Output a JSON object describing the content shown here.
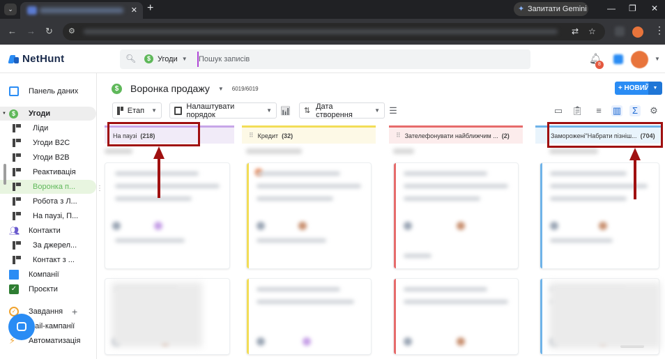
{
  "browser": {
    "gemini_label": "Запитати Gemini",
    "window_controls": [
      "—",
      "❐",
      "✕"
    ],
    "tab_close": "✕",
    "new_tab": "+"
  },
  "header": {
    "logo_text": "NetHunt",
    "search_scope": "Угоди",
    "search_placeholder": "Пошук записів",
    "notification_count": "8",
    "accent_color": "#2a8cf4"
  },
  "sidebar": {
    "items": [
      {
        "label": "Панель даних",
        "icon": "dashboard-icon"
      },
      {
        "label": "Угоди",
        "icon": "dollar-icon"
      },
      {
        "label": "Ліди",
        "icon": "pipeline-icon"
      },
      {
        "label": "Угоди B2C",
        "icon": "pipeline-icon"
      },
      {
        "label": "Угоди B2B",
        "icon": "pipeline-icon"
      },
      {
        "label": "Реактивація",
        "icon": "pipeline-icon"
      },
      {
        "label": "Воронка п...",
        "icon": "pipeline-icon"
      },
      {
        "label": "Робота з Л...",
        "icon": "pipeline-icon"
      },
      {
        "label": "На паузі, П...",
        "icon": "pipeline-icon"
      },
      {
        "label": "Контакти",
        "icon": "people-icon"
      },
      {
        "label": "За джерел...",
        "icon": "pipeline-icon"
      },
      {
        "label": "Контакт з ...",
        "icon": "pipeline-icon"
      },
      {
        "label": "Компанії",
        "icon": "company-icon"
      },
      {
        "label": "Проєкти",
        "icon": "project-icon"
      },
      {
        "label": "Завдання",
        "icon": "task-icon"
      },
      {
        "label": "mail-кампанії",
        "icon": "mail-icon"
      },
      {
        "label": "Автоматизація",
        "icon": "bolt-icon"
      }
    ],
    "active_color": "#5fb85a"
  },
  "main": {
    "pipeline_name": "Воронка продажу",
    "record_count": "6019/6019",
    "new_button": "+ НОВИЙ",
    "controls": {
      "stage": "Етап",
      "order": "Налаштувати порядок",
      "date": "Дата створення"
    },
    "columns": [
      {
        "name": "На паузі",
        "count": "(218)",
        "color": "#c7a6e8",
        "bg": "#f1ebf8"
      },
      {
        "name": "Кредит",
        "count": "(32)",
        "color": "#f2dd57",
        "bg": "#fdf9e6"
      },
      {
        "name": "Зателефонувати найближчим ...",
        "count": "(2)",
        "color": "#e66b6b",
        "bg": "#fcecec"
      },
      {
        "name": "Заморожені\"Набрати пізніш...",
        "count": "(704)",
        "color": "#6fb3e8",
        "bg": "#e9f4fc"
      }
    ]
  },
  "annotation_color": "#a01010"
}
